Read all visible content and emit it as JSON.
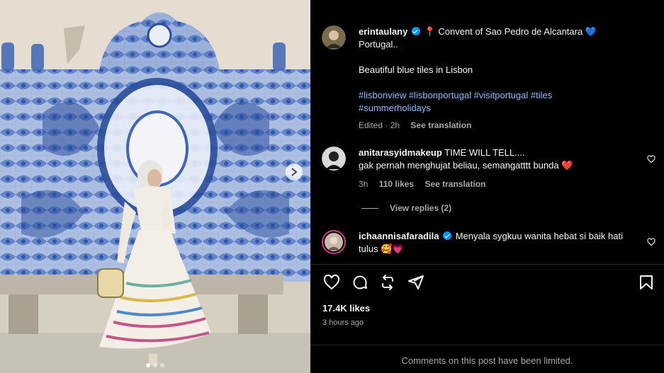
{
  "post": {
    "caption_user": "erintaulany",
    "caption_line1": "📍 Convent of Sao Pedro de Alcantara 💙",
    "caption_line2": "Portugal..",
    "caption_line3": "Beautiful blue tiles in Lisbon",
    "hashtags": [
      "#lisbonview",
      "#lisbonportugal",
      "#visitportugal",
      "#tiles",
      "#summerholidays"
    ],
    "caption_meta_time": "Edited · 2h",
    "see_translation": "See translation"
  },
  "comments": [
    {
      "user": "anitarasyidmakeup",
      "text_line1": "TIME WILL TELL....",
      "text_line2": "gak pernah menghujat beliau, semangatttt bunda ❤️",
      "time": "3h",
      "likes": "110 likes",
      "see_translation": "See translation",
      "view_replies": "View replies (2)"
    },
    {
      "user": "ichaannisafaradila",
      "text_line1": "Menyala sygkuu wanita hebat si baik hati",
      "text_line2": "tulus 🥰💗"
    }
  ],
  "footer": {
    "likes": "17.4K likes",
    "time_ago": "3 hours ago",
    "comments_limited": "Comments on this post have been limited."
  },
  "colors": {
    "background": "#000000",
    "secondary_text": "#a8a8a8",
    "hashtag": "#8fb9ff",
    "verified": "#0095f6",
    "tile_blue": "#3f66b8"
  },
  "carousel": {
    "total": 3,
    "active": 1
  }
}
